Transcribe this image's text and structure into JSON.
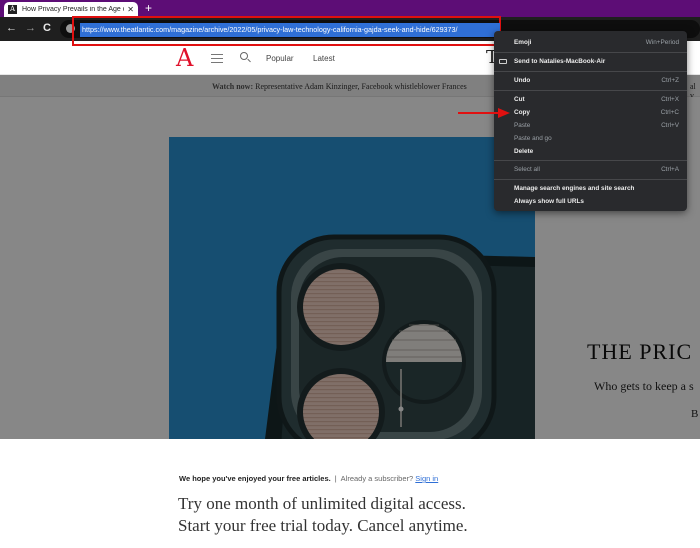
{
  "browser": {
    "tab_title": "How Privacy Prevails in the Age o",
    "tab_favicon": "A",
    "close_glyph": "✕",
    "new_tab_glyph": "+",
    "back_glyph": "←",
    "forward_glyph": "→",
    "reload_glyph": "C",
    "url": "https://www.theatlantic.com/magazine/archive/2022/05/privacy-law-technology-california-gajda-seek-and-hide/629373/"
  },
  "site_header": {
    "logo": "A",
    "popular": "Popular",
    "latest": "Latest",
    "partial_letter": "T"
  },
  "watch_bar": {
    "label": "Watch now:",
    "text": "Representative Adam Kinzinger, Facebook whistleblower Frances",
    "right_fragment": "al v"
  },
  "article": {
    "title_fragment": "THE PRIC",
    "subtitle_fragment": "Who gets to keep a s",
    "byline_fragment": "B"
  },
  "paywall": {
    "lead": "We hope you've enjoyed your free articles.",
    "separator": "|",
    "subscriber_q": "Already a subscriber?",
    "sign_in": "Sign in",
    "headline1": "Try one month of unlimited digital access.",
    "headline2": "Start your free trial today. Cancel anytime."
  },
  "context_menu": {
    "emoji": "Emoji",
    "emoji_shortcut": "Win+Period",
    "send_to": "Send to Natalies-MacBook-Air",
    "undo": "Undo",
    "undo_shortcut": "Ctrl+Z",
    "cut": "Cut",
    "cut_shortcut": "Ctrl+X",
    "copy": "Copy",
    "copy_shortcut": "Ctrl+C",
    "paste": "Paste",
    "paste_shortcut": "Ctrl+V",
    "paste_and_go": "Paste and go",
    "delete": "Delete",
    "select_all": "Select all",
    "select_all_shortcut": "Ctrl+A",
    "manage_search": "Manage search engines and site search",
    "always_show_urls": "Always show full URLs"
  },
  "colors": {
    "tabstrip": "#5d0d76",
    "toolbar": "#1f1f1f",
    "accent_red": "#e01010",
    "url_highlight": "#2f6fd6",
    "logo_red": "#e0112b",
    "hero_blue": "#2a94d6",
    "menu_bg": "#292a2d"
  }
}
